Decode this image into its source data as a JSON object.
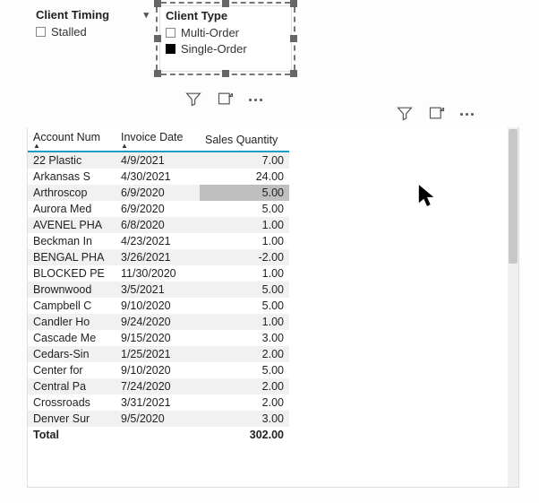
{
  "slicers": {
    "timing": {
      "title": "Client Timing",
      "items": [
        {
          "label": "Stalled",
          "checked": false
        }
      ]
    },
    "type": {
      "title": "Client Type",
      "items": [
        {
          "label": "Multi-Order",
          "checked": false
        },
        {
          "label": "Single-Order",
          "checked": true
        }
      ]
    }
  },
  "table": {
    "columns": {
      "account": "Account Num",
      "invoice": "Invoice Date",
      "qty": "Sales Quantity"
    },
    "rows": [
      {
        "account": "22 Plastic",
        "invoice": "4/9/2021",
        "qty": "7.00"
      },
      {
        "account": "Arkansas S",
        "invoice": "4/30/2021",
        "qty": "24.00"
      },
      {
        "account": "Arthroscop",
        "invoice": "6/9/2020",
        "qty": "5.00"
      },
      {
        "account": "Aurora Med",
        "invoice": "6/9/2020",
        "qty": "5.00"
      },
      {
        "account": "AVENEL PHA",
        "invoice": "6/8/2020",
        "qty": "1.00"
      },
      {
        "account": "Beckman In",
        "invoice": "4/23/2021",
        "qty": "1.00"
      },
      {
        "account": "BENGAL PHA",
        "invoice": "3/26/2021",
        "qty": "-2.00"
      },
      {
        "account": "BLOCKED PE",
        "invoice": "11/30/2020",
        "qty": "1.00"
      },
      {
        "account": "Brownwood",
        "invoice": "3/5/2021",
        "qty": "5.00"
      },
      {
        "account": "Campbell C",
        "invoice": "9/10/2020",
        "qty": "5.00"
      },
      {
        "account": "Candler Ho",
        "invoice": "9/24/2020",
        "qty": "1.00"
      },
      {
        "account": "Cascade Me",
        "invoice": "9/15/2020",
        "qty": "3.00"
      },
      {
        "account": "Cedars-Sin",
        "invoice": "1/25/2021",
        "qty": "2.00"
      },
      {
        "account": "Center for",
        "invoice": "9/10/2020",
        "qty": "5.00"
      },
      {
        "account": "Central Pa",
        "invoice": "7/24/2020",
        "qty": "2.00"
      },
      {
        "account": "Crossroads",
        "invoice": "3/31/2021",
        "qty": "2.00"
      },
      {
        "account": "Denver Sur",
        "invoice": "9/5/2020",
        "qty": "3.00"
      }
    ],
    "total_label": "Total",
    "total_value": "302.00",
    "selected_row_index": 2
  }
}
